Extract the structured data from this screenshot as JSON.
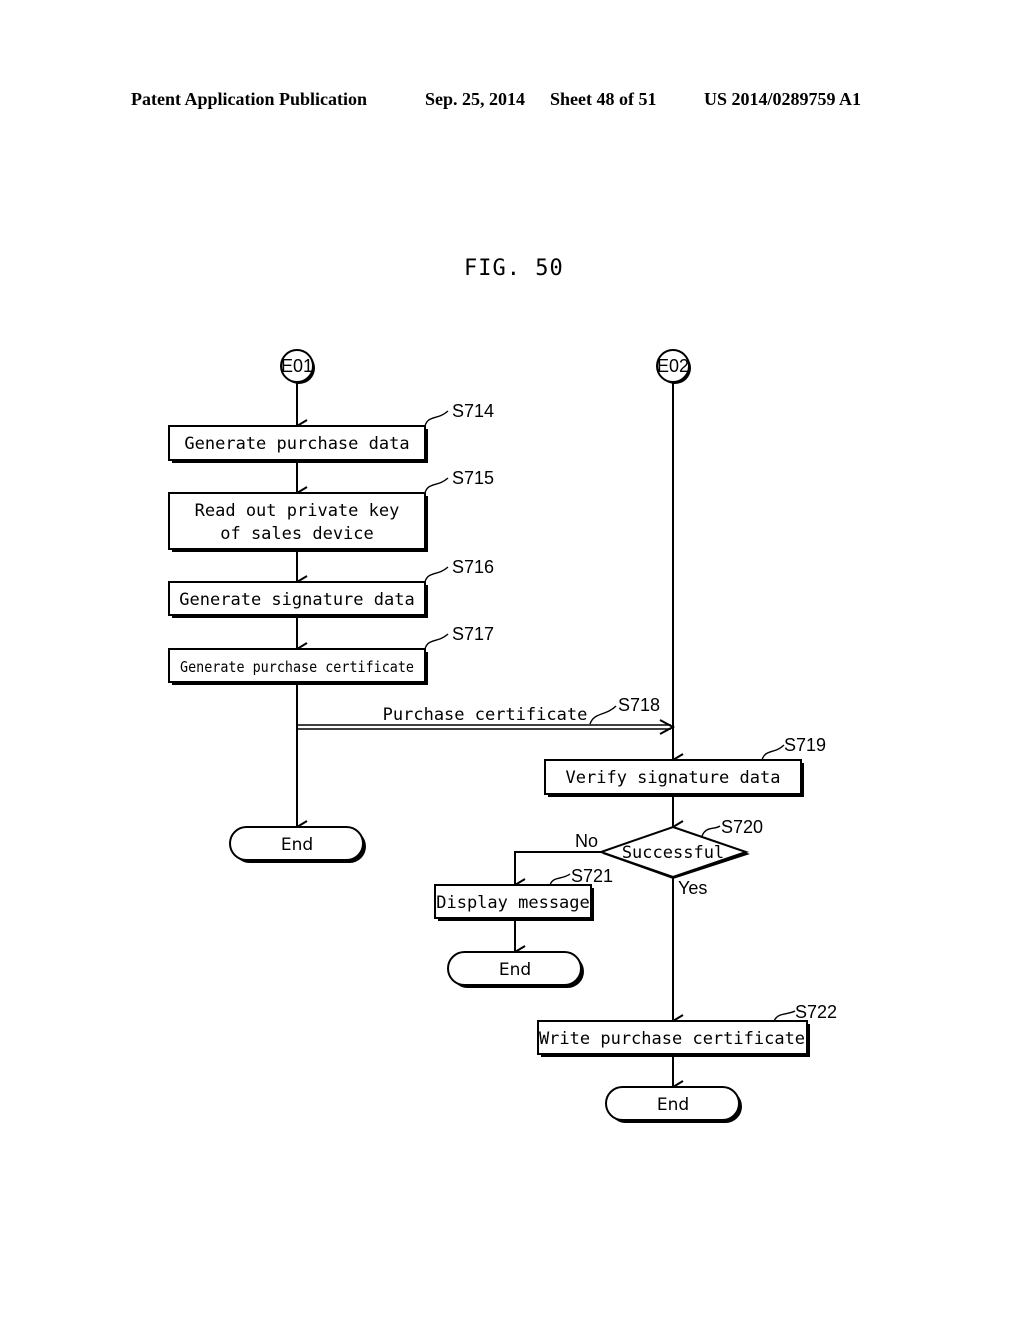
{
  "header": {
    "publication": "Patent Application Publication",
    "date": "Sep. 25, 2014",
    "sheet": "Sheet 48 of 51",
    "number": "US 2014/0289759 A1"
  },
  "figure": {
    "title": "FIG. 50"
  },
  "connectors": {
    "e01": "E01",
    "e02": "E02"
  },
  "steps": {
    "s714": {
      "id": "S714",
      "text": "Generate purchase data"
    },
    "s715": {
      "id": "S715",
      "line1": "Read out private key",
      "line2": "of sales device"
    },
    "s716": {
      "id": "S716",
      "text": "Generate signature data"
    },
    "s717": {
      "id": "S717",
      "text": "Generate purchase certificate"
    },
    "s718": {
      "id": "S718",
      "text": "Purchase certificate"
    },
    "s719": {
      "id": "S719",
      "text": "Verify signature data"
    },
    "s720": {
      "id": "S720",
      "text": "Successful",
      "no": "No",
      "yes": "Yes"
    },
    "s721": {
      "id": "S721",
      "text": "Display message"
    },
    "s722": {
      "id": "S722",
      "text": "Write purchase certificate"
    }
  },
  "terminals": {
    "end_left": "End",
    "end_mid": "End",
    "end_right": "End"
  }
}
